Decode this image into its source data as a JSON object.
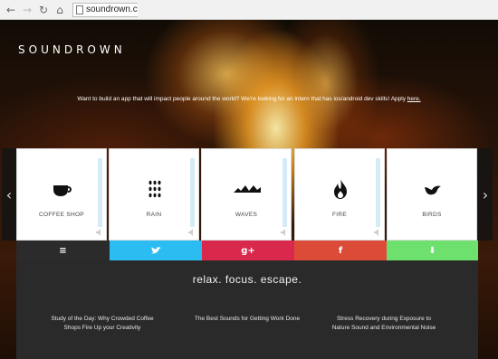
{
  "browser": {
    "url": "soundrown.co"
  },
  "site": {
    "brand": "SOUNDROWN",
    "announcement": "Want to build an app that will impact people around the world? We're looking for an intern that has ios/android dev skills! Apply ",
    "announcement_link": "here."
  },
  "sounds": [
    {
      "label": "COFFEE SHOP",
      "icon": "coffee-cup-icon"
    },
    {
      "label": "RAIN",
      "icon": "raindrops-icon"
    },
    {
      "label": "WAVES",
      "icon": "waves-icon"
    },
    {
      "label": "FIRE",
      "icon": "flame-icon"
    },
    {
      "label": "BIRDS",
      "icon": "bird-icon"
    }
  ],
  "nav": {
    "prev": "‹",
    "next": "›"
  },
  "share": {
    "menu": "≡",
    "twitter": "🐦",
    "googleplus": "g+",
    "facebook": "f",
    "appstore": "⬇",
    "colors": {
      "menu": "#2b2b2b",
      "twitter": "#2bbcf2",
      "googleplus": "#d8284c",
      "facebook": "#dc4b38",
      "appstore": "#6ee06e"
    }
  },
  "tagline": "relax. focus. escape.",
  "articles": [
    {
      "title": "Study of the Day: Why Crowded Coffee Shops Fire Up your Creativity"
    },
    {
      "title": "The Best Sounds for Getting Work Done"
    },
    {
      "title": "Stress Recovery during Exposure to Nature Sound and Environmental Noise"
    }
  ]
}
